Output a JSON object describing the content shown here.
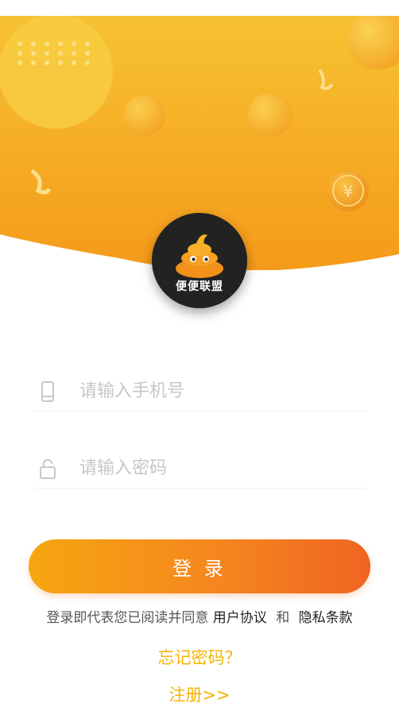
{
  "brand": {
    "logo_text": "便便联盟"
  },
  "form": {
    "phone_placeholder": "请输入手机号",
    "password_placeholder": "请输入密码"
  },
  "actions": {
    "login_label": "登 录",
    "forgot_label": "忘记密码？",
    "register_label": "注册>>"
  },
  "agreement": {
    "prefix": "登录即代表您已阅读并同意",
    "user_agreement": "用户协议",
    "conjunction": "和",
    "privacy_policy": "隐私条款"
  },
  "colors": {
    "accent": "#f4b400",
    "button_start": "#f6a611",
    "button_end": "#f06422",
    "hero_top": "#f7bf2f",
    "hero_bottom": "#f59a1a"
  },
  "icons": {
    "phone": "mobile-phone-icon",
    "password": "lock-icon"
  }
}
